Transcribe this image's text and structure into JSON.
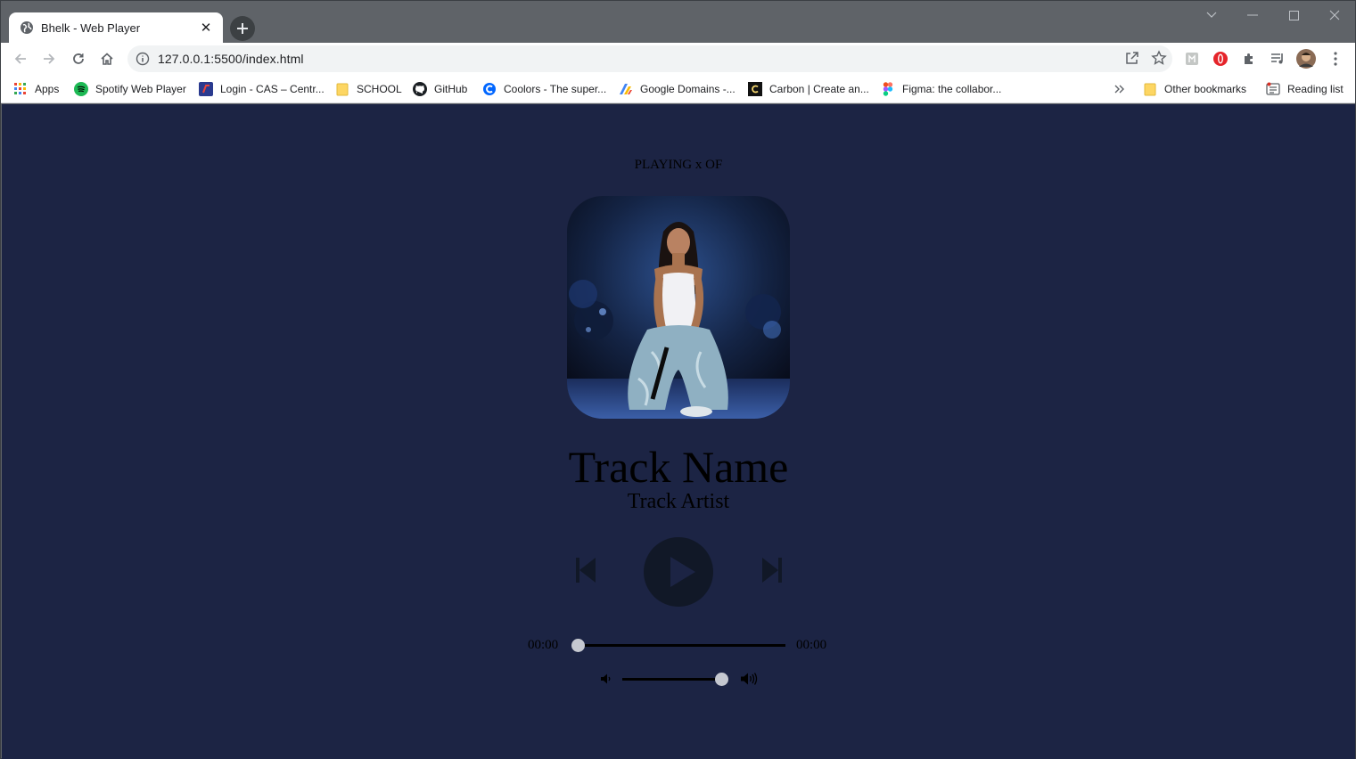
{
  "browser": {
    "tab_title": "Bhelk - Web Player",
    "url": "127.0.0.1:5500/index.html",
    "bookmarks": [
      {
        "label": "Apps",
        "icon": "apps-grid-icon"
      },
      {
        "label": "Spotify Web Player",
        "icon": "spotify-icon"
      },
      {
        "label": "Login - CAS – Centr...",
        "icon": "cas-icon"
      },
      {
        "label": "SCHOOL",
        "icon": "folder-icon"
      },
      {
        "label": "GitHub",
        "icon": "github-icon"
      },
      {
        "label": "Coolors - The super...",
        "icon": "coolors-icon"
      },
      {
        "label": "Google Domains -...",
        "icon": "google-domains-icon"
      },
      {
        "label": "Carbon | Create an...",
        "icon": "carbon-icon"
      },
      {
        "label": "Figma: the collabor...",
        "icon": "figma-icon"
      }
    ],
    "other_bookmarks": "Other bookmarks",
    "reading_list": "Reading list"
  },
  "player": {
    "playing_label": "PLAYING x OF",
    "track_name": "Track Name",
    "track_artist": "Track Artist",
    "current_time": "00:00",
    "total_time": "00:00",
    "seek_progress": 0,
    "volume_level": 0.99
  },
  "colors": {
    "page_background": "#1c2444",
    "control_color": "#111827",
    "slider_thumb": "#c5c8d0"
  }
}
